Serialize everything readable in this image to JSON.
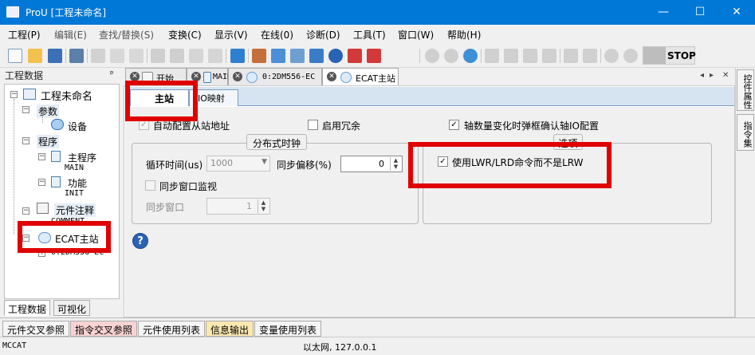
{
  "window": {
    "title": "ProU [工程未命名]",
    "minimize": "—",
    "maximize": "☐",
    "close": "✕"
  },
  "menu": [
    "工程(P)",
    "编辑(E)",
    "查找/替换(S)",
    "变换(C)",
    "显示(V)",
    "在线(0)",
    "诊断(D)",
    "工具(T)",
    "窗口(W)",
    "帮助(H)"
  ],
  "toolbar": {
    "stop_label": "STOP"
  },
  "left_panel": {
    "header": "工程数据",
    "pin": "ᵖ",
    "tree": {
      "root": "工程未命名",
      "params": "参数",
      "device": "设备",
      "program": "程序",
      "main_program": "主程序",
      "main": "MAIN",
      "function": "功能",
      "init": "INIT",
      "comment_group": "元件注释",
      "comment": "COMMENT",
      "ecat_master": "ECAT主站",
      "ecat_slave": "0:2DM556-EC"
    },
    "tabs": [
      "工程数据",
      "可视化"
    ]
  },
  "doc_tabs": [
    {
      "label": "开始"
    },
    {
      "label": "MAIN"
    },
    {
      "label": "0:2DM556-EC"
    },
    {
      "label": "ECAT主站"
    }
  ],
  "doc_tab_nav": {
    "left": "◂",
    "right": "▸",
    "close": "✕"
  },
  "sub_tabs": [
    "主站",
    "IO映射"
  ],
  "form": {
    "auto_config": "自动配置从站地址",
    "enable_redundancy": "启用冗余",
    "axis_change_confirm": "轴数量变化时弹框确认轴IO配置",
    "dc_group_title": "分布式时钟",
    "cycle_time_label": "循环时间(us)",
    "cycle_time_value": "1000",
    "sync_offset_label": "同步偏移(%)",
    "sync_offset_value": "0",
    "sync_window_monitor": "同步窗口监视",
    "sync_window_label": "同步窗口",
    "sync_window_value": "1",
    "options_group_title": "选项",
    "use_lwr_lrd": "使用LWR/LRD命令而不是LRW",
    "help": "?"
  },
  "right_tabs": [
    "控件属性",
    "指令集"
  ],
  "bottom_tabs": [
    {
      "label": "元件交叉参照",
      "bg": "#f5f5f5"
    },
    {
      "label": "指令交叉参照",
      "bg": "#f9d3d3"
    },
    {
      "label": "元件使用列表",
      "bg": "#f5f5f5"
    },
    {
      "label": "信息输出",
      "bg": "#fbe8b0"
    },
    {
      "label": "变量使用列表",
      "bg": "#f5f5f5"
    }
  ],
  "status": {
    "left": "MCCAT",
    "center": "以太网, 127.0.0.1"
  },
  "colors": {
    "titlebar": "#0078d7",
    "highlight": "#e00000"
  }
}
